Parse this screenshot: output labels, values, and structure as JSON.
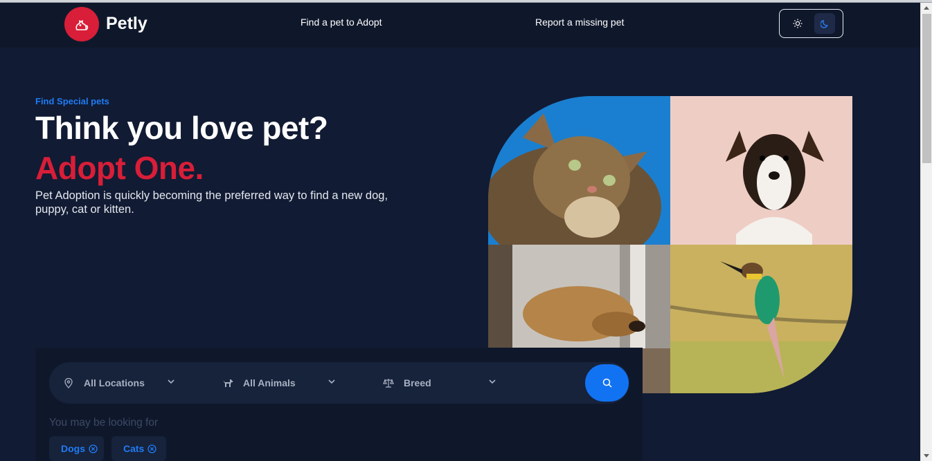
{
  "app": {
    "name": "Petly"
  },
  "nav": {
    "adopt": "Find a pet to Adopt",
    "missing": "Report a missing pet"
  },
  "theme": {
    "light_icon": "sun-icon",
    "dark_icon": "moon-icon",
    "active": "dark"
  },
  "hero": {
    "eyebrow": "Find Special pets",
    "headline": "Think you love pet?",
    "headline_accent": "Adopt One.",
    "description": "Pet Adoption is quickly becoming the preferred way to find a new dog, puppy, cat or kitten."
  },
  "search": {
    "location": "All Locations",
    "animal": "All Animals",
    "breed": "Breed",
    "hint": "You may be looking for",
    "chips": [
      "Dogs",
      "Cats"
    ]
  },
  "colors": {
    "brand_red": "#d81e38",
    "accent_blue": "#1f7cf5",
    "background": "#111b33"
  }
}
